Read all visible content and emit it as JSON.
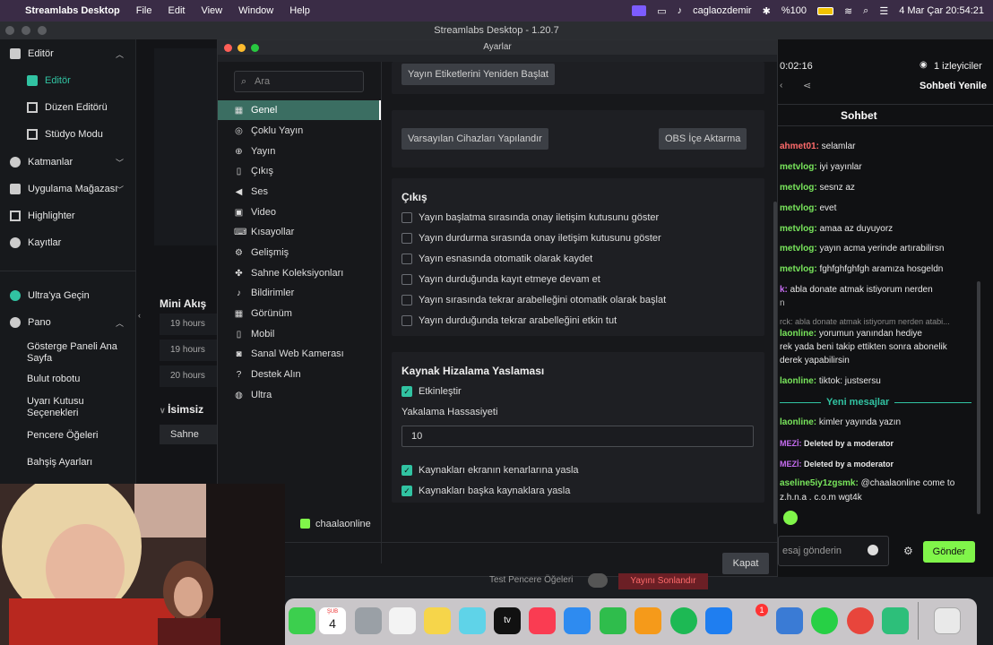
{
  "menubar": {
    "app_name": "Streamlabs Desktop",
    "menus": [
      "File",
      "Edit",
      "View",
      "Window",
      "Help"
    ],
    "user": "caglaozdemir",
    "battery": "%100",
    "datetime": "4 Mar Çar  20:54:21"
  },
  "app_title": "Streamlabs Desktop - 1.20.7",
  "sidebar": {
    "editor_section": "Editör",
    "editor_item": "Editör",
    "layout_editor": "Düzen Editörü",
    "studio_mode": "Stüdyo Modu",
    "themes": "Katmanlar",
    "app_store": "Uygulama Mağazası",
    "highlighter": "Highlighter",
    "recordings": "Kayıtlar",
    "ultra": "Ultra'ya Geçin",
    "dashboard": "Pano",
    "dashboard_home": "Gösterge Paneli Ana Sayfa",
    "cloudbot": "Bulut robotu",
    "alertbox": "Uyarı Kutusu Seçenekleri",
    "widgets": "Pencere Öğeleri",
    "tip_settings": "Bahşiş Ayarları"
  },
  "editor": {
    "mini_feed": "Mini Akış",
    "hours": [
      "19 hours",
      "19 hours",
      "20 hours"
    ],
    "unnamed": "İsimsiz",
    "scene": "Sahne"
  },
  "dialog": {
    "title": "Ayarlar",
    "search_placeholder": "Ara",
    "nav": [
      {
        "label": "Genel",
        "icon": "grid"
      },
      {
        "label": "Çoklu Yayın",
        "icon": "broadcast"
      },
      {
        "label": "Yayın",
        "icon": "globe"
      },
      {
        "label": "Çıkış",
        "icon": "file"
      },
      {
        "label": "Ses",
        "icon": "speaker"
      },
      {
        "label": "Video",
        "icon": "video"
      },
      {
        "label": "Kısayollar",
        "icon": "keyboard"
      },
      {
        "label": "Gelişmiş",
        "icon": "cogs"
      },
      {
        "label": "Sahne Koleksiyonları",
        "icon": "collections"
      },
      {
        "label": "Bildirimler",
        "icon": "bell"
      },
      {
        "label": "Görünüm",
        "icon": "grid"
      },
      {
        "label": "Mobil",
        "icon": "phone"
      },
      {
        "label": "Sanal Web Kamerası",
        "icon": "camera"
      },
      {
        "label": "Destek Alın",
        "icon": "help"
      },
      {
        "label": "Ultra",
        "icon": "ultra"
      }
    ],
    "restart_tags": "Yayın Etiketlerini Yeniden Başlat",
    "configure_devices": "Varsayılan Cihazları Yapılandır",
    "obs_import": "OBS İçe Aktarma",
    "output_title": "Çıkış",
    "output_options": [
      {
        "label": "Yayın başlatma sırasında onay iletişim kutusunu göster",
        "checked": false
      },
      {
        "label": "Yayın durdurma sırasında onay iletişim kutusunu göster",
        "checked": false
      },
      {
        "label": "Yayın esnasında otomatik olarak kaydet",
        "checked": false
      },
      {
        "label": "Yayın durduğunda kayıt etmeye devam et",
        "checked": false
      },
      {
        "label": "Yayın sırasında tekrar arabelleğini otomatik olarak başlat",
        "checked": false
      },
      {
        "label": "Yayın durduğunda tekrar arabelleğini etkin tut",
        "checked": false
      }
    ],
    "snap_title": "Kaynak Hizalama Yaslaması",
    "enable_label": "Etkinleştir",
    "sensitivity_label": "Yakalama Hassasiyeti",
    "sensitivity_value": "10",
    "snap_edges": "Kaynakları ekranın kenarlarına yasla",
    "snap_sources": "Kaynakları başka kaynaklara yasla",
    "close_button": "Kapat",
    "account_name": "chaalaonline"
  },
  "chat": {
    "timer": "0:02:16",
    "viewers": "1 izleyiciler",
    "refresh": "Sohbeti Yenile",
    "tab": "Sohbet",
    "new_messages": "Yeni mesajlar",
    "input_placeholder": "esaj gönderin",
    "send": "Gönder",
    "messages": [
      {
        "user": "ahmet01:",
        "text": " selamlar"
      },
      {
        "user": "metvlog:",
        "text": " iyi yayınlar"
      },
      {
        "user": "metvlog:",
        "text": " sesnz az"
      },
      {
        "user": "metvlog:",
        "text": " evet"
      },
      {
        "user": "metvlog:",
        "text": " amaa az duyuyorz"
      },
      {
        "user": "metvlog:",
        "text": " yayın acma yerinde artırabilirsn"
      },
      {
        "user": "metvlog:",
        "text": " fghfghfghfgh aramıza hosgeldn"
      },
      {
        "user": "k:",
        "text": " abla donate atmak istiyorum nerden"
      },
      {
        "user": "",
        "text": "rck: abla donate atmak istiyorum nerden atabi..."
      },
      {
        "user": "laonline:",
        "text": " yorumun yanından hediye"
      },
      {
        "user": "",
        "text": "rek yada beni takip ettikten sonra abonelik"
      },
      {
        "user": "",
        "text": "derek yapabilirsin"
      },
      {
        "user": "laonline:",
        "text": " tiktok: justsersu"
      },
      {
        "user": "laonline:",
        "text": " kimler yayında yazın"
      },
      {
        "user": "MEZİ:",
        "text": " Deleted by a moderator"
      },
      {
        "user": "MEZİ:",
        "text": " Deleted by a moderator"
      },
      {
        "user": "aseline5iy1zgsmk:",
        "text": " @chaalaonline come to"
      },
      {
        "user": "",
        "text": "z.h.n.a . c.o.m wgt4k"
      }
    ]
  },
  "bottom_labels": {
    "test_widgets": "Test Pencere Öğeleri",
    "end_stream": "Yayını Sonlandır"
  },
  "dock": {
    "calendar_month": "ŞUB",
    "calendar_day": "4",
    "appstore_badge": "1"
  },
  "colors": {
    "accent": "#31c3a2",
    "menubar": "#3a2c46",
    "send": "#80f54a"
  }
}
